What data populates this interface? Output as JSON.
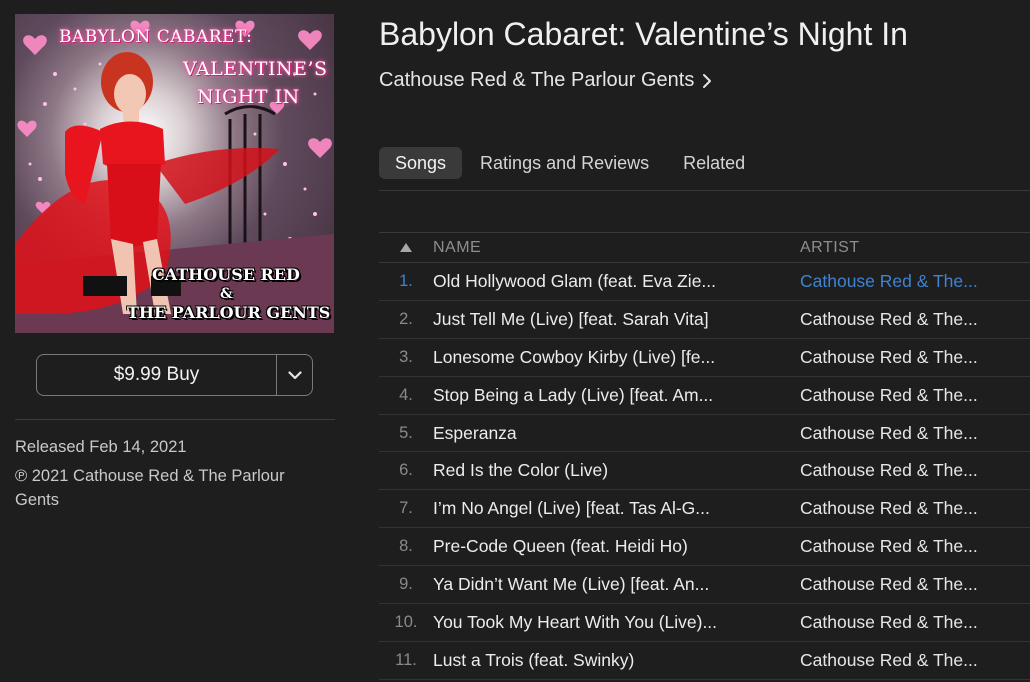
{
  "album": {
    "title": "Babylon Cabaret: Valentine’s Night In",
    "artist": "Cathouse Red & The Parlour Gents"
  },
  "artwork": {
    "title_line1": "BABYLON CABARET:",
    "title_line2": "VALENTINE’S",
    "title_line3": "NIGHT IN",
    "artist_line1": "CATHOUSE RED",
    "artist_line2": "&",
    "artist_line3": "THE PARLOUR GENTS"
  },
  "purchase": {
    "buy_label": "$9.99 Buy"
  },
  "details": {
    "released": "Released Feb 14, 2021",
    "copyright": "℗ 2021 Cathouse Red & The Parlour Gents"
  },
  "tabs": [
    {
      "label": "Songs",
      "active": true
    },
    {
      "label": "Ratings and Reviews",
      "active": false
    },
    {
      "label": "Related",
      "active": false
    }
  ],
  "table": {
    "headers": {
      "name": "NAME",
      "artist": "ARTIST"
    },
    "rows": [
      {
        "num": "1.",
        "name": "Old Hollywood Glam (feat. Eva Zie...",
        "artist": "Cathouse Red & The..."
      },
      {
        "num": "2.",
        "name": "Just Tell Me (Live) [feat. Sarah Vita]",
        "artist": "Cathouse Red & The..."
      },
      {
        "num": "3.",
        "name": "Lonesome Cowboy Kirby (Live) [fe...",
        "artist": "Cathouse Red & The..."
      },
      {
        "num": "4.",
        "name": "Stop Being a Lady (Live) [feat. Am...",
        "artist": "Cathouse Red & The..."
      },
      {
        "num": "5.",
        "name": "Esperanza",
        "artist": "Cathouse Red & The..."
      },
      {
        "num": "6.",
        "name": "Red Is the Color (Live)",
        "artist": "Cathouse Red & The..."
      },
      {
        "num": "7.",
        "name": "I’m No Angel (Live) [feat. Tas Al-G...",
        "artist": "Cathouse Red & The..."
      },
      {
        "num": "8.",
        "name": "Pre-Code Queen (feat. Heidi Ho)",
        "artist": "Cathouse Red & The..."
      },
      {
        "num": "9.",
        "name": "Ya Didn’t Want Me (Live) [feat. An...",
        "artist": "Cathouse Red & The..."
      },
      {
        "num": "10.",
        "name": "You Took My Heart With You (Live)...",
        "artist": "Cathouse Red & The..."
      },
      {
        "num": "11.",
        "name": "Lust a Trois (feat. Swinky)",
        "artist": "Cathouse Red & The..."
      }
    ]
  },
  "colors": {
    "background": "#1e1e1e",
    "accent": "#3f83d1",
    "active_tab": "#3a3a3a"
  },
  "icons": {
    "artist_link": "chevron-right-icon",
    "buy_menu": "chevron-down-icon",
    "sort": "sort-ascending-icon"
  }
}
